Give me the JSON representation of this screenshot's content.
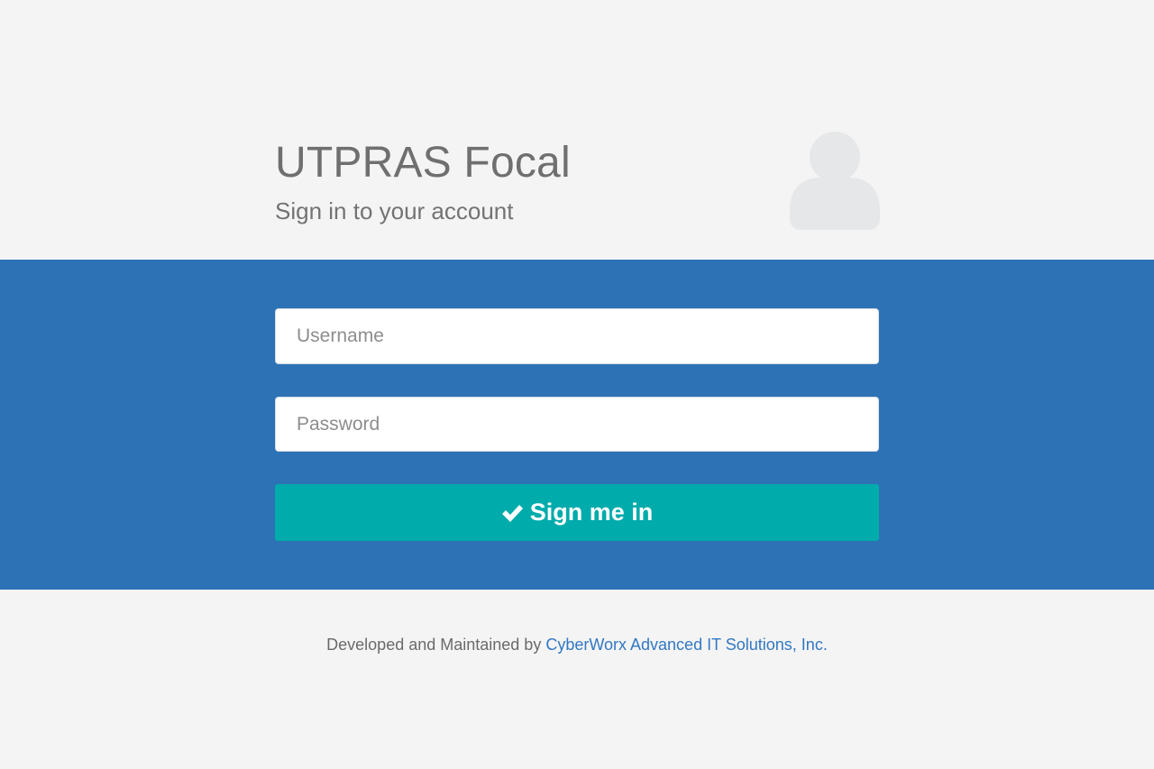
{
  "header": {
    "title": "UTPRAS Focal",
    "subtitle": "Sign in to your account",
    "avatar_icon": "user-avatar-icon"
  },
  "form": {
    "username_placeholder": "Username",
    "username_value": "",
    "password_placeholder": "Password",
    "password_value": "",
    "submit_label": "Sign me in",
    "submit_icon": "check-icon"
  },
  "footer": {
    "prefix": "Developed and Maintained by ",
    "link_text": "CyberWorx Advanced IT Solutions, Inc."
  },
  "colors": {
    "background": "#f4f4f4",
    "band": "#2c72b5",
    "button": "#00abab",
    "link": "#3277c3",
    "avatar": "#e6e7e9"
  }
}
